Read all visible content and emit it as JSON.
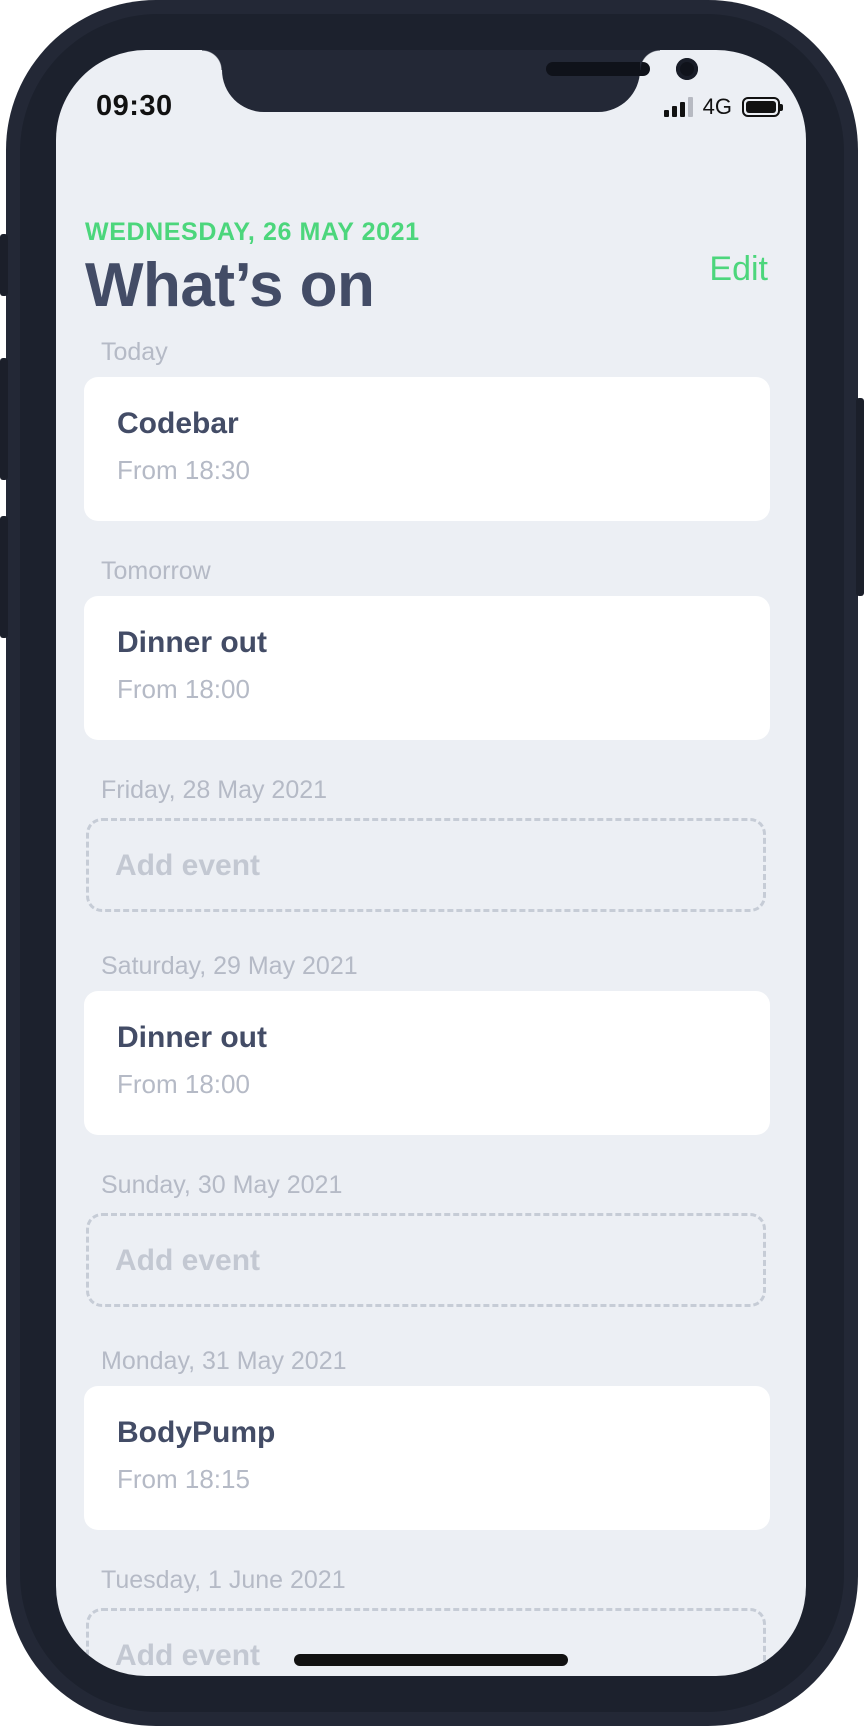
{
  "status_bar": {
    "time": "09:30",
    "network": "4G",
    "signal_icon": "cellular-signal-icon",
    "battery_icon": "battery-icon"
  },
  "header": {
    "date": "WEDNESDAY, 26 MAY 2021",
    "title": "What’s on",
    "edit_label": "Edit",
    "accent_color": "#4cd67c"
  },
  "days": [
    {
      "label": "Today",
      "event": {
        "title": "Codebar",
        "time": "From 18:30"
      }
    },
    {
      "label": "Tomorrow",
      "event": {
        "title": "Dinner out",
        "time": "From 18:00"
      }
    },
    {
      "label": "Friday, 28 May 2021",
      "empty_label": "Add event"
    },
    {
      "label": "Saturday, 29 May 2021",
      "event": {
        "title": "Dinner out",
        "time": "From 18:00"
      }
    },
    {
      "label": "Sunday, 30 May 2021",
      "empty_label": "Add event"
    },
    {
      "label": "Monday, 31 May 2021",
      "event": {
        "title": "BodyPump",
        "time": "From 18:15"
      }
    },
    {
      "label": "Tuesday, 1 June 2021",
      "empty_label": "Add event"
    }
  ]
}
